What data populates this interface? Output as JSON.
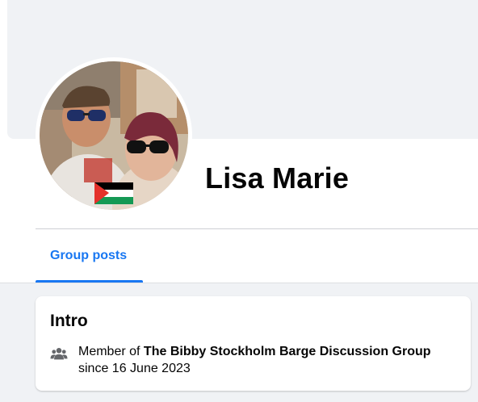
{
  "profile": {
    "name": "Lisa Marie"
  },
  "tabs": [
    {
      "label": "Group posts",
      "active": true
    }
  ],
  "intro": {
    "title": "Intro",
    "member_prefix": "Member of ",
    "group_name": "The Bibby Stockholm Barge Discussion Group",
    "since_text": "since 16 June 2023",
    "icon": "group-members-icon"
  },
  "colors": {
    "accent": "#1877f2",
    "page_background": "#f0f2f5",
    "text_primary": "#050505",
    "icon_gray": "#65676b"
  }
}
